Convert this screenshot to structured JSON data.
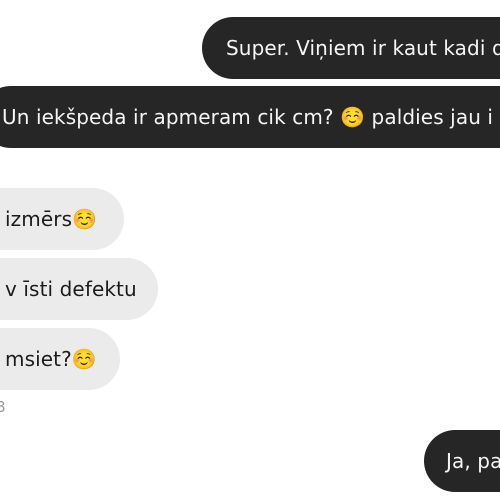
{
  "messages": [
    {
      "direction": "outgoing",
      "text": "Super. Viņiem ir kaut kadi d"
    },
    {
      "direction": "outgoing",
      "text": "Un iekšpeda ir apmeram cik cm? ☺️  paldies jau i"
    },
    {
      "direction": "incoming",
      "text": "izmērs☺️"
    },
    {
      "direction": "incoming",
      "text": "v īsti defektu"
    },
    {
      "direction": "incoming",
      "text": "msiet?☺️"
    },
    {
      "direction": "outgoing",
      "text": "Ja, pa"
    }
  ],
  "timestamp": "8",
  "colors": {
    "outgoing_bubble": "#262626",
    "outgoing_text": "#f5f5f5",
    "incoming_bubble": "#ebebeb",
    "incoming_text": "#1c1c1c",
    "timestamp_text": "#9a9a9a"
  }
}
